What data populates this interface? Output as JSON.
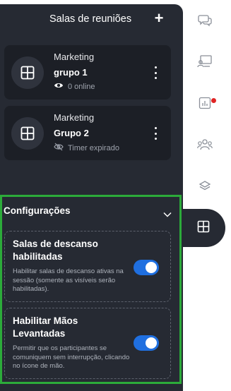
{
  "panel": {
    "title": "Salas de reuniões",
    "add_label": "+"
  },
  "groups": [
    {
      "department": "Marketing",
      "name": "grupo 1",
      "status": "0 online",
      "status_icon": "eye-icon"
    },
    {
      "department": "Marketing",
      "name": "Grupo 2",
      "status": "Timer expirado",
      "status_icon": "eye-slash-icon"
    }
  ],
  "settings": {
    "title": "Configurações",
    "options": [
      {
        "title": "Salas de descanso habilitadas",
        "description": "Habilitar salas de descanso ativas na sessão (somente as visíveis serão habilitadas).",
        "enabled": true
      },
      {
        "title": "Habilitar Mãos Levantadas",
        "description": "Permitir que os participantes se comuniquem sem interrupção, clicando no ícone de mão.",
        "enabled": true
      }
    ]
  },
  "sidebar": {
    "items": [
      "chat-icon",
      "presentation-icon",
      "poll-chart-icon",
      "participants-icon",
      "layers-icon",
      "breakout-rooms-icon"
    ],
    "active": "breakout-rooms-icon",
    "notification_on": "poll-chart-icon"
  },
  "colors": {
    "panel_bg": "#262a33",
    "card_bg": "#1c1f26",
    "accent": "#1f6fe0",
    "highlight_border": "#2cab3a",
    "notification": "#e02424"
  }
}
